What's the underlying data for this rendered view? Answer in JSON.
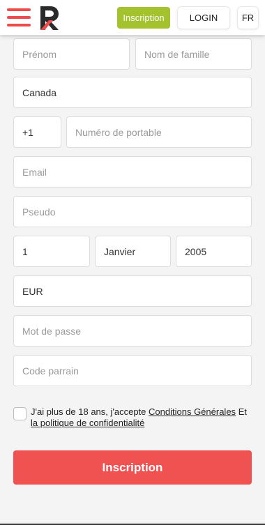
{
  "header": {
    "signup_label": "Inscription",
    "login_label": "LOGIN",
    "language": "FR",
    "logo_letter": "R"
  },
  "form": {
    "first_name": {
      "placeholder": "Prénom",
      "value": ""
    },
    "last_name": {
      "placeholder": "Nom de famille",
      "value": ""
    },
    "country": {
      "value": "Canada"
    },
    "phone_code": {
      "value": "+1"
    },
    "phone": {
      "placeholder": "Numéro de portable",
      "value": ""
    },
    "email": {
      "placeholder": "Email",
      "value": ""
    },
    "username": {
      "placeholder": "Pseudo",
      "value": ""
    },
    "birth_day": {
      "value": "1"
    },
    "birth_month": {
      "value": "Janvier"
    },
    "birth_year": {
      "value": "2005"
    },
    "currency": {
      "value": "EUR"
    },
    "password": {
      "placeholder": "Mot de passe",
      "value": ""
    },
    "referral_code": {
      "placeholder": "Code parrain",
      "value": ""
    }
  },
  "terms": {
    "prefix": "J'ai plus de 18 ans, j'accepte",
    "conditions_link": "Conditions Générales",
    "conjunction": "Et",
    "privacy_link": "la politique de confidentialité",
    "checked": false
  },
  "submit_label": "Inscription",
  "colors": {
    "accent_red": "#f05151",
    "signup_green": "#a4c12e",
    "logo_dark": "#2b2b2b",
    "background": "#f4f4f4"
  },
  "icons": {
    "menu": "hamburger-menu-icon",
    "logo": "brand-logo-icon"
  }
}
